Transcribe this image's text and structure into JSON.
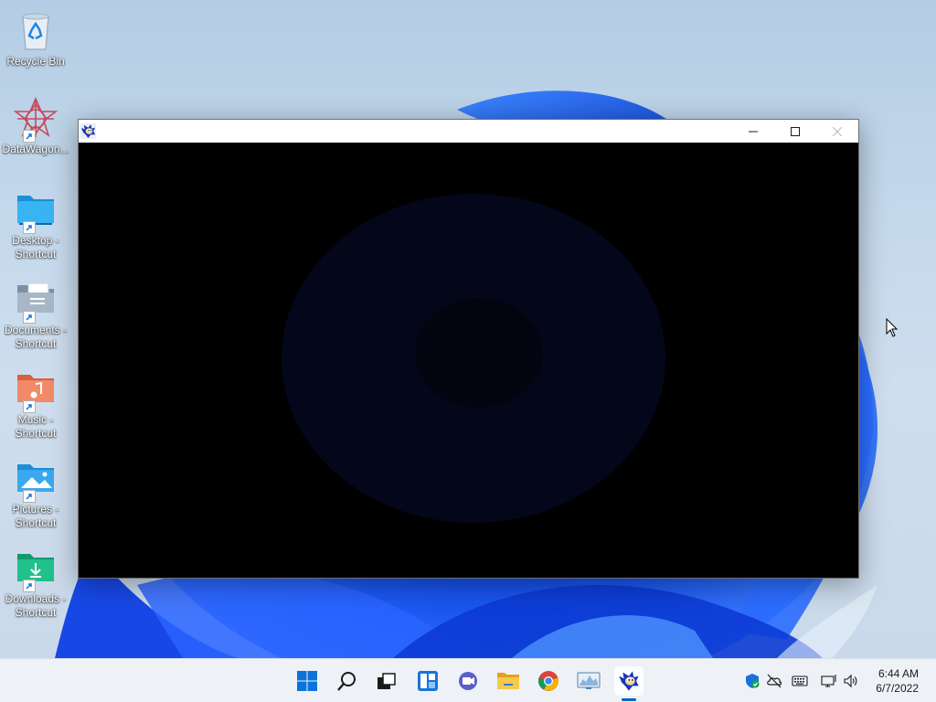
{
  "desktop": {
    "icons": [
      {
        "label": "Recycle Bin",
        "icon": "recycle-bin-icon"
      },
      {
        "label": "DataWagon...",
        "icon": "datawagon-icon"
      },
      {
        "label": "Desktop - Shortcut",
        "icon": "desktop-folder-icon"
      },
      {
        "label": "Documents - Shortcut",
        "icon": "documents-folder-icon"
      },
      {
        "label": "Music - Shortcut",
        "icon": "music-folder-icon"
      },
      {
        "label": "Pictures - Shortcut",
        "icon": "pictures-folder-icon"
      },
      {
        "label": "Downloads - Shortcut",
        "icon": "downloads-folder-icon"
      }
    ]
  },
  "window": {
    "app_icon": "sonic-icon",
    "title": "",
    "controls": [
      "minimize-icon",
      "maximize-icon",
      "close-icon"
    ],
    "content_background": "#000000"
  },
  "taskbar": {
    "buttons": [
      {
        "name": "start",
        "icon": "windows-logo-icon"
      },
      {
        "name": "search",
        "icon": "search-icon"
      },
      {
        "name": "task-view",
        "icon": "task-view-icon"
      },
      {
        "name": "widgets",
        "icon": "widgets-icon"
      },
      {
        "name": "chat",
        "icon": "chat-icon"
      },
      {
        "name": "file-explorer",
        "icon": "folder-icon"
      },
      {
        "name": "chrome",
        "icon": "chrome-icon"
      },
      {
        "name": "monitor-app",
        "icon": "monitor-chart-icon"
      },
      {
        "name": "sonic-app",
        "icon": "sonic-icon",
        "active": true
      }
    ],
    "tray": [
      "security-shield-icon",
      "onedrive-offline-icon",
      "keyboard-icon",
      "network-icon",
      "volume-icon"
    ],
    "time": "6:44 AM",
    "date": "6/7/2022"
  },
  "colors": {
    "accent": "#0067c0",
    "wallpaper_bloom": "#1e5cff",
    "taskbar_bg": "#eef2f7"
  }
}
